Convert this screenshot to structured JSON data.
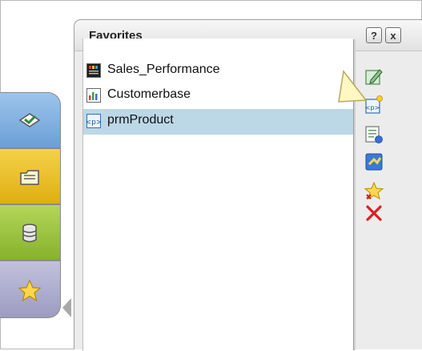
{
  "panel": {
    "title": "Favorites",
    "help_label": "?",
    "close_label": "x"
  },
  "favorites": [
    {
      "label": "Sales_Performance",
      "icon": "report-dark-icon",
      "selected": false
    },
    {
      "label": "Customerbase",
      "icon": "chart-report-icon",
      "selected": false
    },
    {
      "label": "prmProduct",
      "icon": "parameter-icon",
      "selected": true
    }
  ],
  "toolbar": [
    {
      "name": "edit-icon"
    },
    {
      "name": "new-parameter-icon"
    },
    {
      "name": "properties-icon"
    },
    {
      "name": "connect-icon"
    },
    {
      "name": "remove-favorite-icon"
    },
    {
      "name": "delete-icon"
    }
  ],
  "side_tabs": [
    {
      "name": "navigate-icon"
    },
    {
      "name": "folder-icon"
    },
    {
      "name": "database-icon"
    },
    {
      "name": "star-icon"
    }
  ],
  "colors": {
    "selection": "#bcd8e7",
    "tab_blue": "#7aaae0",
    "tab_yellow": "#e8bd24",
    "tab_green": "#98c23e",
    "tab_purple": "#aaaacb"
  }
}
